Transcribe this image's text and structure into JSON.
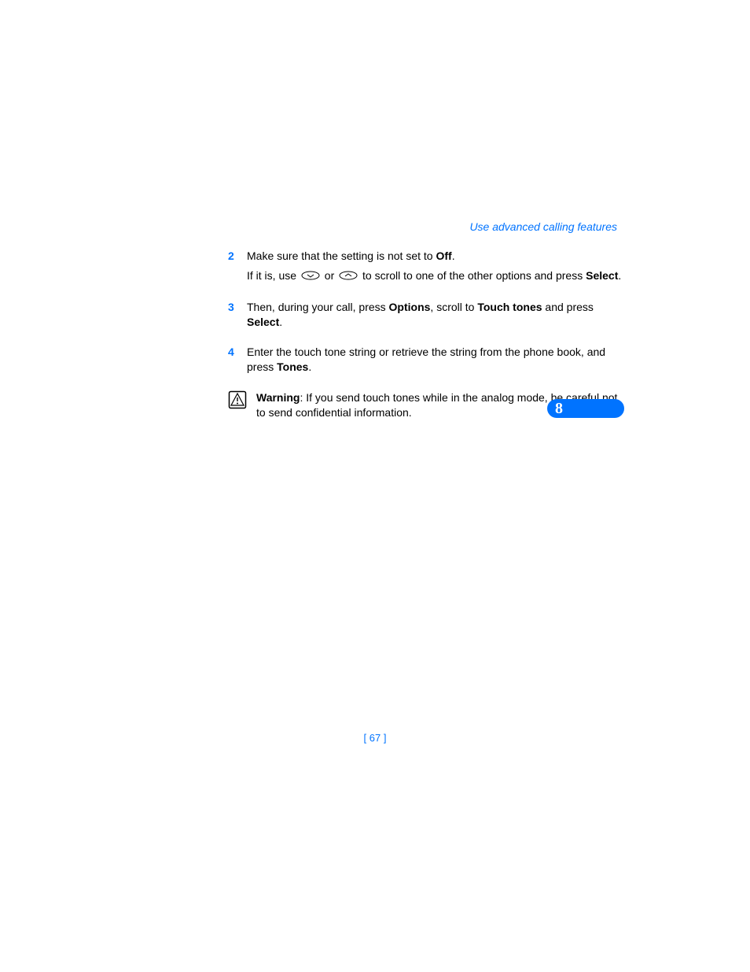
{
  "header": {
    "title": "Use advanced calling features"
  },
  "steps": [
    {
      "num": "2",
      "line1a": "Make sure that the setting is not set to ",
      "line1b": "Off",
      "line1c": ".",
      "line2a": "If it is, use ",
      "line2b": " or ",
      "line2c": " to scroll to one of the other options and press ",
      "line2d": "Select",
      "line2e": "."
    },
    {
      "num": "3",
      "a": "Then, during your call, press ",
      "b": "Options",
      "c": ", scroll to ",
      "d": "Touch tones",
      "e": " and press ",
      "f": "Select",
      "g": "."
    },
    {
      "num": "4",
      "a": "Enter the touch tone string or retrieve the string from the phone book, and press ",
      "b": "Tones",
      "c": "."
    }
  ],
  "warning": {
    "label": "Warning",
    "text": ": If you send touch tones while in the analog mode, be careful not to send confidential information."
  },
  "chapter": "8",
  "page_label": "[ 67 ]"
}
